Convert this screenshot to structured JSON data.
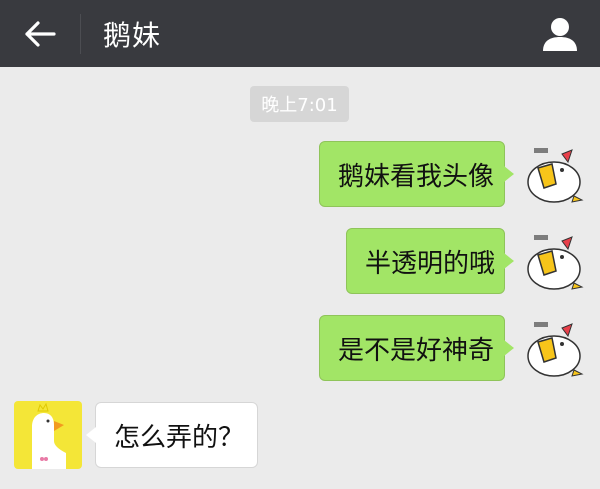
{
  "header": {
    "back_icon": "arrow-left-icon",
    "title": "鹅妹",
    "profile_icon": "person-icon"
  },
  "chat": {
    "timestamp": "晚上7:01",
    "messages": [
      {
        "direction": "out",
        "text": "鹅妹看我头像"
      },
      {
        "direction": "out",
        "text": "半透明的哦"
      },
      {
        "direction": "out",
        "text": "是不是好神奇"
      },
      {
        "direction": "in",
        "text": "怎么弄的？"
      }
    ]
  },
  "colors": {
    "topbar": "#393a3f",
    "background": "#ebebeb",
    "outgoing_bubble": "#a2e566",
    "incoming_bubble": "#ffffff",
    "incoming_avatar_bg": "#f4e637"
  }
}
